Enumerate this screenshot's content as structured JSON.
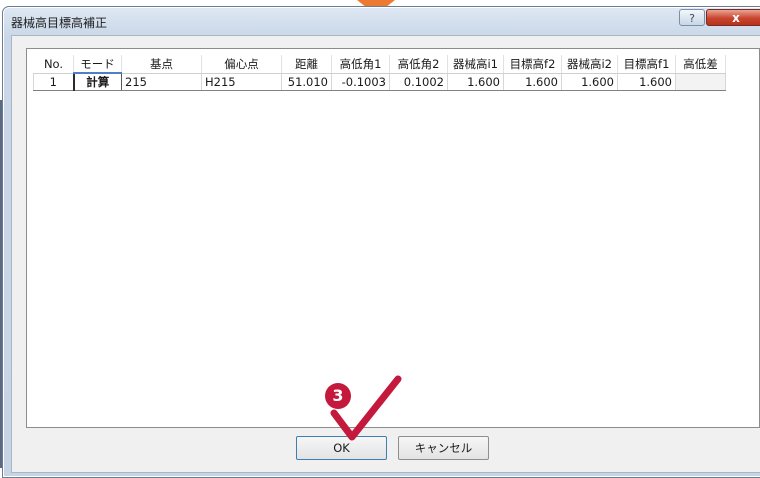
{
  "window": {
    "title": "器械高目標高補正",
    "help_label": "?",
    "close_label": "x"
  },
  "table": {
    "headers": [
      "No.",
      "モード",
      "基点",
      "偏心点",
      "距離",
      "高低角1",
      "高低角2",
      "器械高i1",
      "目標高f2",
      "器械高i2",
      "目標高f1",
      "高低差"
    ],
    "rows": [
      [
        "1",
        "計算",
        "215",
        "H215",
        "51.010",
        "-0.1003",
        "0.1002",
        "1.600",
        "1.600",
        "1.600",
        "1.600",
        ""
      ]
    ]
  },
  "buttons": {
    "ok_label": "OK",
    "cancel_label": "キャンセル"
  },
  "annotation": {
    "step_number": "3"
  },
  "colors": {
    "arrow": "#ec7a32",
    "badge": "#c4183c",
    "check": "#c4183c",
    "close_button": "#c9452f"
  },
  "icons": [
    "help-icon",
    "close-icon",
    "checkmark-icon"
  ]
}
